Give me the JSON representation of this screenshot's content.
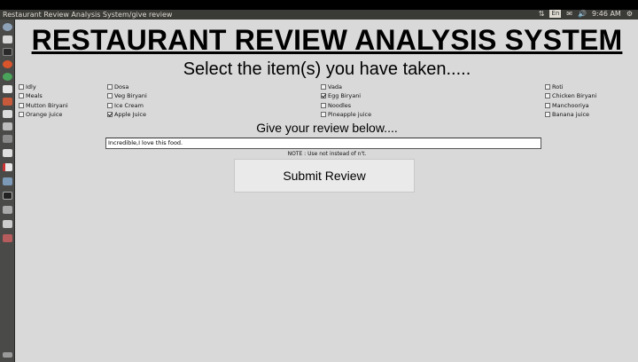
{
  "window": {
    "title": "Restaurant Review Analysis System/give review"
  },
  "tray": {
    "keyboard": "En",
    "time": "9:46 AM"
  },
  "app": {
    "heading": "RESTAURANT REVIEW ANALYSIS SYSTEM",
    "subheading": "Select the item(s) you have taken.....",
    "review_heading": "Give your review below....",
    "review_value": "Incredible,I love this food.",
    "note": "NOTE : Use not instead of n't.",
    "submit_label": "Submit Review"
  },
  "items": [
    {
      "label": "Idly",
      "checked": false
    },
    {
      "label": "Dosa",
      "checked": false
    },
    {
      "label": "Vada",
      "checked": false
    },
    {
      "label": "Roti",
      "checked": false
    },
    {
      "label": "Meals",
      "checked": false
    },
    {
      "label": "Veg Biryani",
      "checked": false
    },
    {
      "label": "Egg Biryani",
      "checked": true
    },
    {
      "label": "Chicken Biryani",
      "checked": false
    },
    {
      "label": "Mutton Biryani",
      "checked": false
    },
    {
      "label": "Ice Cream",
      "checked": false
    },
    {
      "label": "Noodles",
      "checked": false
    },
    {
      "label": "Manchooriya",
      "checked": false
    },
    {
      "label": "Orange juice",
      "checked": false
    },
    {
      "label": "Apple Juice",
      "checked": true
    },
    {
      "label": "Pineapple juice",
      "checked": false
    },
    {
      "label": "Banana juice",
      "checked": false
    }
  ]
}
